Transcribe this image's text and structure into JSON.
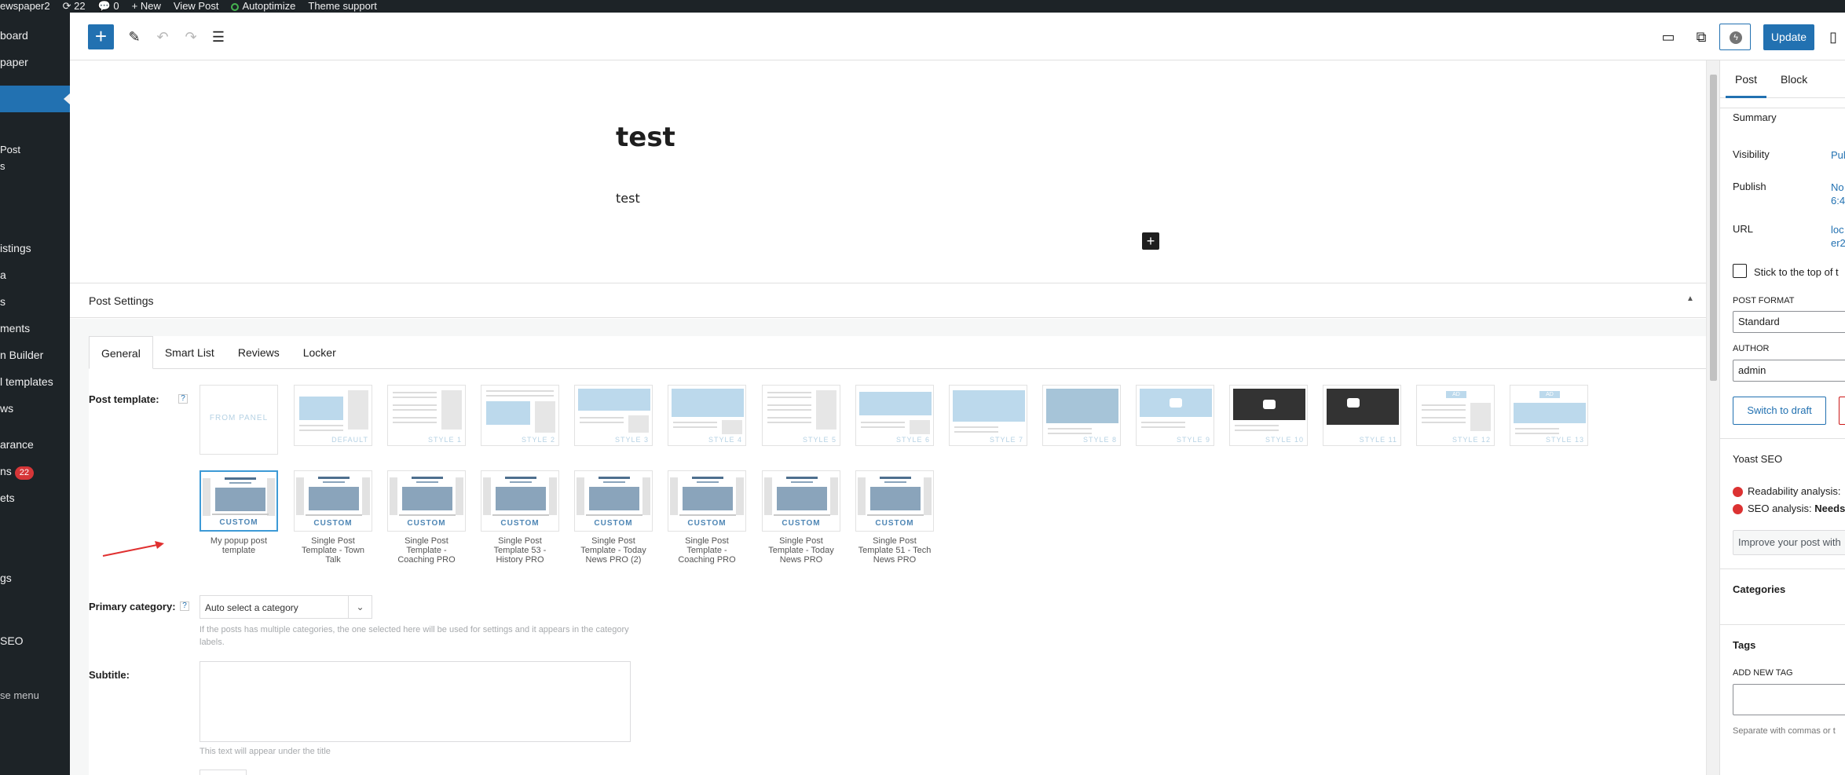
{
  "adminbar": {
    "site": "ewspaper2",
    "updates": "22",
    "comments": "0",
    "new": "New",
    "view_post": "View Post",
    "autoptimize": "Autoptimize",
    "theme_support": "Theme support"
  },
  "sidebar": {
    "items": [
      "board",
      "paper",
      "Post",
      "s",
      "istings",
      "a",
      "s",
      "ments",
      "n Builder",
      "l templates",
      "ws",
      "arance",
      "ns",
      "ets",
      "gs",
      "SEO",
      "se menu"
    ],
    "plugins_badge": "22"
  },
  "toolbar": {
    "add": "+",
    "update": "Update"
  },
  "editor": {
    "title": "test",
    "body": "test"
  },
  "metabox": {
    "title": "Post Settings",
    "tabs": [
      "General",
      "Smart List",
      "Reviews",
      "Locker"
    ],
    "post_template_label": "Post template:",
    "help": "?",
    "templates": [
      "FROM PANEL",
      "DEFAULT",
      "STYLE 1",
      "STYLE 2",
      "STYLE 3",
      "STYLE 4",
      "STYLE 5",
      "STYLE 6",
      "STYLE 7",
      "STYLE 8",
      "STYLE 9",
      "STYLE 10",
      "STYLE 11",
      "STYLE 12",
      "STYLE 13"
    ],
    "custom_label": "CUSTOM",
    "custom_templates": [
      "My popup post template",
      "Single Post Template - Town Talk",
      "Single Post Template - Coaching PRO",
      "Single Post Template 53 - History PRO",
      "Single Post Template - Today News PRO (2)",
      "Single Post Template - Coaching PRO",
      "Single Post Template - Today News PRO",
      "Single Post Template 51 - Tech News PRO"
    ],
    "primary_category_label": "Primary category:",
    "primary_category_value": "Auto select a category",
    "primary_category_hint": "If the posts has multiple categories, the one selected here will be used for settings and it appears in the category labels.",
    "subtitle_label": "Subtitle:",
    "subtitle_hint": "This text will appear under the title"
  },
  "right_sidebar": {
    "tabs": [
      "Post",
      "Block"
    ],
    "summary": "Summary",
    "visibility_label": "Visibility",
    "visibility_value": "Pul",
    "publish_label": "Publish",
    "publish_value": "No",
    "publish_value2": "6:4",
    "url_label": "URL",
    "url_value": "loc",
    "url_value2": "er2",
    "sticky": "Stick to the top of t",
    "post_format_label": "POST FORMAT",
    "post_format_value": "Standard",
    "author_label": "AUTHOR",
    "author_value": "admin",
    "switch_to_draft": "Switch to draft",
    "yoast_title": "Yoast SEO",
    "readability": "Readability analysis:",
    "seo_analysis": "SEO analysis:",
    "seo_status": "Needs i",
    "improve": "Improve your post with",
    "categories": "Categories",
    "tags": "Tags",
    "add_new_tag": "ADD NEW TAG",
    "tag_hint": "Separate with commas or t"
  },
  "colors": {
    "accent": "#2271b1",
    "admin_dark": "#1d2327",
    "error": "#d63638"
  }
}
